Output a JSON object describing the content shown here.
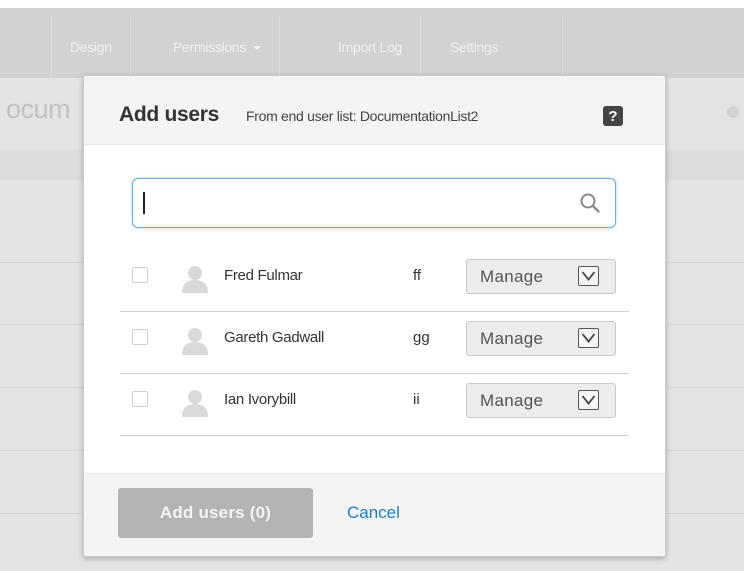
{
  "nav": {
    "items": [
      {
        "label": "Design"
      },
      {
        "label": "Permissions"
      },
      {
        "label": "Import Log"
      },
      {
        "label": "Settings"
      }
    ]
  },
  "background": {
    "page_title_fragment": "ocum"
  },
  "modal": {
    "title": "Add users",
    "subtitle": "From end user list: DocumentationList2",
    "help_icon_glyph": "?",
    "search": {
      "value": "",
      "placeholder": ""
    },
    "users": [
      {
        "name": "Fred Fulmar",
        "code": "ff",
        "role": "Manage",
        "checked": false
      },
      {
        "name": "Gareth Gadwall",
        "code": "gg",
        "role": "Manage",
        "checked": false
      },
      {
        "name": "Ian Ivorybill",
        "code": "ii",
        "role": "Manage",
        "checked": false
      }
    ],
    "footer": {
      "add_button_label": "Add users (0)",
      "cancel_label": "Cancel"
    }
  },
  "icons": {
    "search": "search-icon",
    "avatar": "user-avatar-icon",
    "dropdown": "chevron-down-icon",
    "help": "help-icon"
  },
  "colors": {
    "accent_link": "#1f7ec3",
    "search_focus_border": "#66aee0",
    "disabled_button": "#b3b3b3",
    "nav_background": "#d1d2d2"
  }
}
